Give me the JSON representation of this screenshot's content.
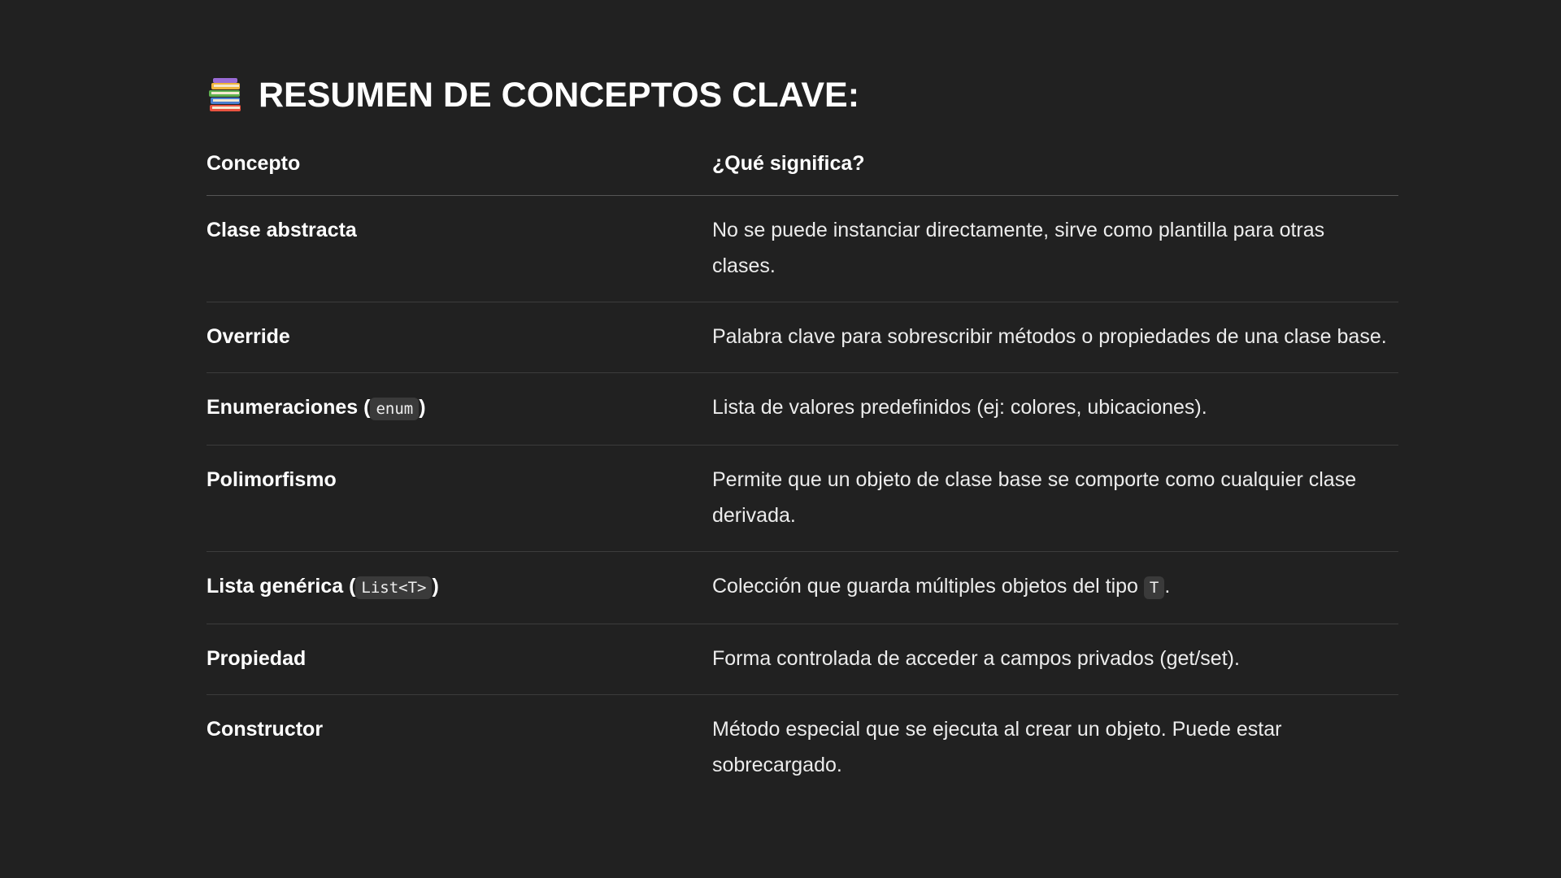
{
  "heading": {
    "icon": "books-icon",
    "text": "RESUMEN DE CONCEPTOS CLAVE:"
  },
  "table": {
    "headers": {
      "concept": "Concepto",
      "meaning": "¿Qué significa?"
    },
    "rows": [
      {
        "concept": "Clase abstracta",
        "meaning": "No se puede instanciar directamente, sirve como plantilla para otras clases."
      },
      {
        "concept": "Override",
        "meaning": "Palabra clave para sobrescribir métodos o propiedades de una clase base."
      },
      {
        "concept": "Enumeraciones (",
        "concept_code": "enum",
        "concept_after": ")",
        "meaning": "Lista de valores predefinidos (ej: colores, ubicaciones)."
      },
      {
        "concept": "Polimorfismo",
        "meaning": "Permite que un objeto de clase base se comporte como cualquier clase derivada."
      },
      {
        "concept": "Lista genérica (",
        "concept_code": "List<T>",
        "concept_after": ")",
        "meaning": "Colección que guarda múltiples objetos del tipo ",
        "meaning_code": "T",
        "meaning_after": "."
      },
      {
        "concept": "Propiedad",
        "meaning": "Forma controlada de acceder a campos privados (get/set)."
      },
      {
        "concept": "Constructor",
        "meaning": "Método especial que se ejecuta al crear un objeto. Puede estar sobrecargado."
      }
    ]
  },
  "colors": {
    "background": "#212121",
    "text": "#ececec",
    "code_background": "#3a3a3a"
  }
}
